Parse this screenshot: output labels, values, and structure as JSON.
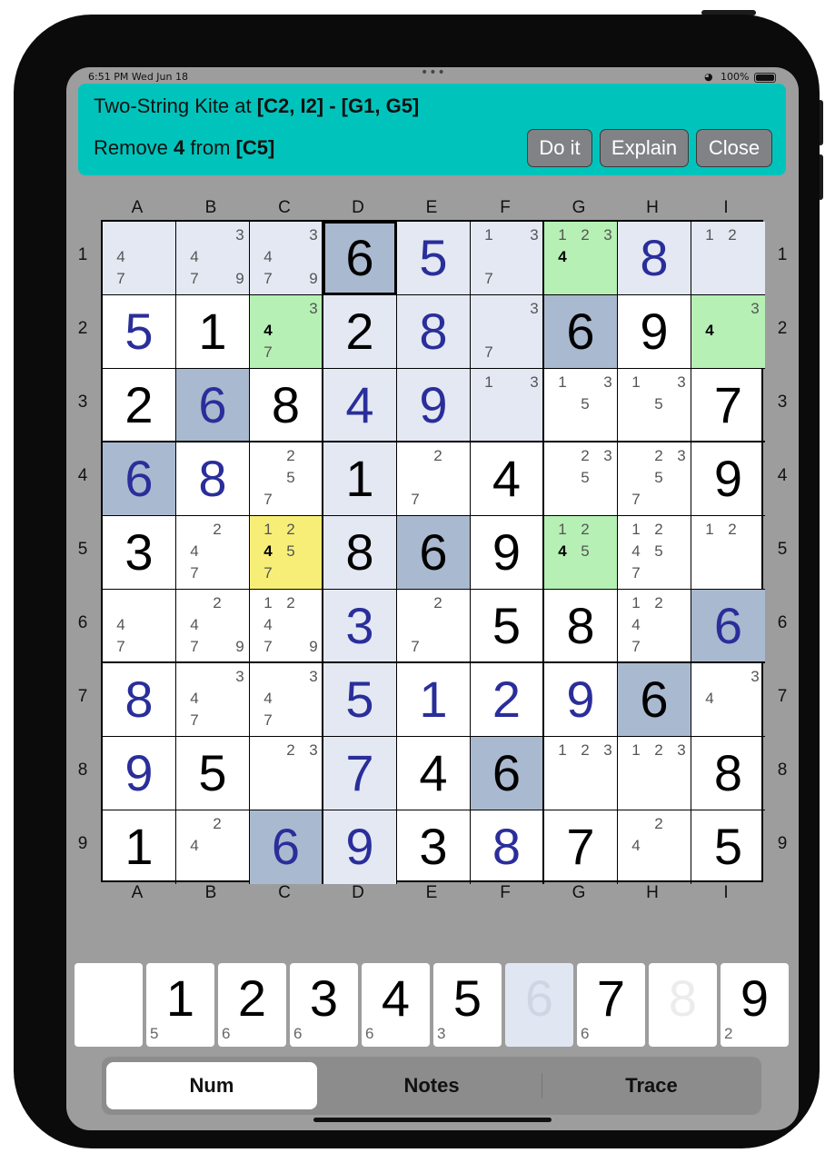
{
  "status": {
    "time": "6:51 PM  Wed Jun 18",
    "battery": "100%"
  },
  "hint": {
    "technique": "Two-String Kite",
    "at_word": "at",
    "cells": "[C2, I2] - [G1, G5]",
    "remove_word": "Remove",
    "digit": "4",
    "from_word": "from",
    "target": "[C5]",
    "buttons": [
      "Do it",
      "Explain",
      "Close"
    ]
  },
  "columns": [
    "A",
    "B",
    "C",
    "D",
    "E",
    "F",
    "G",
    "H",
    "I"
  ],
  "rows": [
    "1",
    "2",
    "3",
    "4",
    "5",
    "6",
    "7",
    "8",
    "9"
  ],
  "colors": {
    "given": "#000000",
    "entered": "#2a2e9a",
    "selected_digit_bg": "#a9b9cf",
    "highlight_bg": "#e3e8f3",
    "kite_cell_bg": "#b6f0b4",
    "target_cell_bg": "#f7ee77"
  },
  "grid": [
    [
      "",
      "",
      "",
      "6",
      "5",
      "",
      "",
      "8",
      ""
    ],
    [
      "5",
      "1",
      "",
      "2",
      "8",
      "",
      "6",
      "9",
      ""
    ],
    [
      "2",
      "6",
      "8",
      "4",
      "9",
      "",
      "",
      "",
      "7"
    ],
    [
      "6",
      "8",
      "",
      "1",
      "",
      "4",
      "",
      "",
      "9"
    ],
    [
      "3",
      "",
      "",
      "8",
      "6",
      "9",
      "",
      "",
      ""
    ],
    [
      "",
      "",
      "",
      "3",
      "",
      "5",
      "8",
      "",
      "6"
    ],
    [
      "8",
      "",
      "",
      "5",
      "1",
      "2",
      "9",
      "6",
      ""
    ],
    [
      "9",
      "5",
      "",
      "7",
      "4",
      "6",
      "",
      "",
      "8"
    ],
    [
      "1",
      "",
      "6",
      "9",
      "3",
      "8",
      "7",
      "",
      "5"
    ]
  ],
  "cell_kind": [
    [
      "",
      "",
      "",
      "g",
      "e",
      "",
      "",
      "e",
      ""
    ],
    [
      "e",
      "g",
      "",
      "g",
      "e",
      "",
      "g",
      "g",
      ""
    ],
    [
      "g",
      "e",
      "g",
      "e",
      "e",
      "",
      "",
      "",
      "g"
    ],
    [
      "e",
      "e",
      "",
      "g",
      "",
      "g",
      "",
      "",
      "g"
    ],
    [
      "g",
      "",
      "",
      "g",
      "g",
      "g",
      "",
      "",
      ""
    ],
    [
      "",
      "",
      "",
      "e",
      "",
      "g",
      "g",
      "",
      "e"
    ],
    [
      "e",
      "",
      "",
      "e",
      "e",
      "e",
      "e",
      "g",
      ""
    ],
    [
      "e",
      "g",
      "",
      "e",
      "g",
      "g",
      "",
      "",
      "g"
    ],
    [
      "g",
      "",
      "e",
      "e",
      "g",
      "e",
      "g",
      "",
      "g"
    ]
  ],
  "cell_bg": [
    [
      "h",
      "h",
      "h",
      "s",
      "h",
      "h",
      "k",
      "h",
      "h"
    ],
    [
      "",
      "",
      "k",
      "h",
      "h",
      "h",
      "s",
      "",
      "k"
    ],
    [
      "",
      "s",
      "",
      "h",
      "h",
      "h",
      "",
      "",
      ""
    ],
    [
      "s",
      "",
      "",
      "h",
      "",
      "",
      "",
      "",
      ""
    ],
    [
      "",
      "",
      "t",
      "h",
      "s",
      "",
      "k",
      "",
      ""
    ],
    [
      "",
      "",
      "",
      "h",
      "",
      "",
      "",
      "",
      "s"
    ],
    [
      "",
      "",
      "",
      "h",
      "",
      "",
      "",
      "s",
      ""
    ],
    [
      "",
      "",
      "",
      "h",
      "",
      "s",
      "",
      "",
      ""
    ],
    [
      "",
      "",
      "s",
      "h",
      "",
      "",
      "",
      "",
      ""
    ]
  ],
  "notes": [
    [
      [
        4,
        7
      ],
      [
        3,
        4,
        7,
        9
      ],
      [
        3,
        4,
        7,
        9
      ],
      [],
      [],
      [
        1,
        3,
        7
      ],
      [
        1,
        2,
        3,
        4
      ],
      [],
      [
        1,
        2
      ]
    ],
    [
      [],
      [],
      [
        3,
        4,
        7
      ],
      [],
      [],
      [
        3,
        7
      ],
      [],
      [],
      [
        3,
        4
      ]
    ],
    [
      [],
      [],
      [],
      [],
      [],
      [
        1,
        3
      ],
      [
        1,
        3,
        5
      ],
      [
        1,
        3,
        5
      ],
      []
    ],
    [
      [],
      [],
      [
        2,
        5,
        7
      ],
      [],
      [
        2,
        7
      ],
      [],
      [
        2,
        3,
        5
      ],
      [
        2,
        3,
        5,
        7
      ],
      []
    ],
    [
      [],
      [
        2,
        4,
        7
      ],
      [
        1,
        2,
        4,
        5,
        7
      ],
      [],
      [],
      [],
      [
        1,
        2,
        4,
        5
      ],
      [
        1,
        2,
        4,
        5,
        7
      ],
      [
        1,
        2
      ]
    ],
    [
      [
        4,
        7
      ],
      [
        2,
        4,
        7,
        9
      ],
      [
        1,
        2,
        4,
        7,
        9
      ],
      [],
      [
        2,
        7
      ],
      [],
      [],
      [
        1,
        2,
        4,
        7
      ],
      []
    ],
    [
      [],
      [
        3,
        4,
        7
      ],
      [
        3,
        4,
        7
      ],
      [],
      [],
      [],
      [],
      [],
      [
        3,
        4
      ]
    ],
    [
      [],
      [],
      [
        2,
        3
      ],
      [],
      [],
      [],
      [
        1,
        2,
        3
      ],
      [
        1,
        2,
        3
      ],
      []
    ],
    [
      [],
      [
        2,
        4
      ],
      [],
      [],
      [],
      [],
      [],
      [
        2,
        4
      ],
      []
    ]
  ],
  "note_highlight": [
    [
      [],
      [],
      [],
      [],
      [],
      [],
      [
        4
      ],
      [],
      []
    ],
    [
      [],
      [],
      [
        4
      ],
      [],
      [],
      [],
      [],
      [],
      [
        4
      ]
    ],
    [
      [],
      [],
      [],
      [],
      [],
      [],
      [],
      [],
      []
    ],
    [
      [],
      [],
      [],
      [],
      [],
      [],
      [],
      [],
      []
    ],
    [
      [],
      [],
      [
        4
      ],
      [],
      [],
      [],
      [
        4
      ],
      [],
      []
    ],
    [
      [],
      [],
      [],
      [],
      [],
      [],
      [],
      [],
      []
    ],
    [
      [],
      [],
      [],
      [],
      [],
      [],
      [],
      [],
      []
    ],
    [
      [],
      [],
      [],
      [],
      [],
      [],
      [],
      [],
      []
    ],
    [
      [],
      [],
      [],
      [],
      [],
      [],
      [],
      [],
      []
    ]
  ],
  "keypad": [
    {
      "digit": "",
      "count": ""
    },
    {
      "digit": "1",
      "count": "5"
    },
    {
      "digit": "2",
      "count": "6"
    },
    {
      "digit": "3",
      "count": "6"
    },
    {
      "digit": "4",
      "count": "6"
    },
    {
      "digit": "5",
      "count": "3"
    },
    {
      "digit": "6",
      "count": "",
      "state": "selected"
    },
    {
      "digit": "7",
      "count": "6"
    },
    {
      "digit": "8",
      "count": "",
      "state": "done"
    },
    {
      "digit": "9",
      "count": "2"
    }
  ],
  "modes": {
    "num": "Num",
    "notes": "Notes",
    "trace": "Trace",
    "selected": "Num"
  }
}
